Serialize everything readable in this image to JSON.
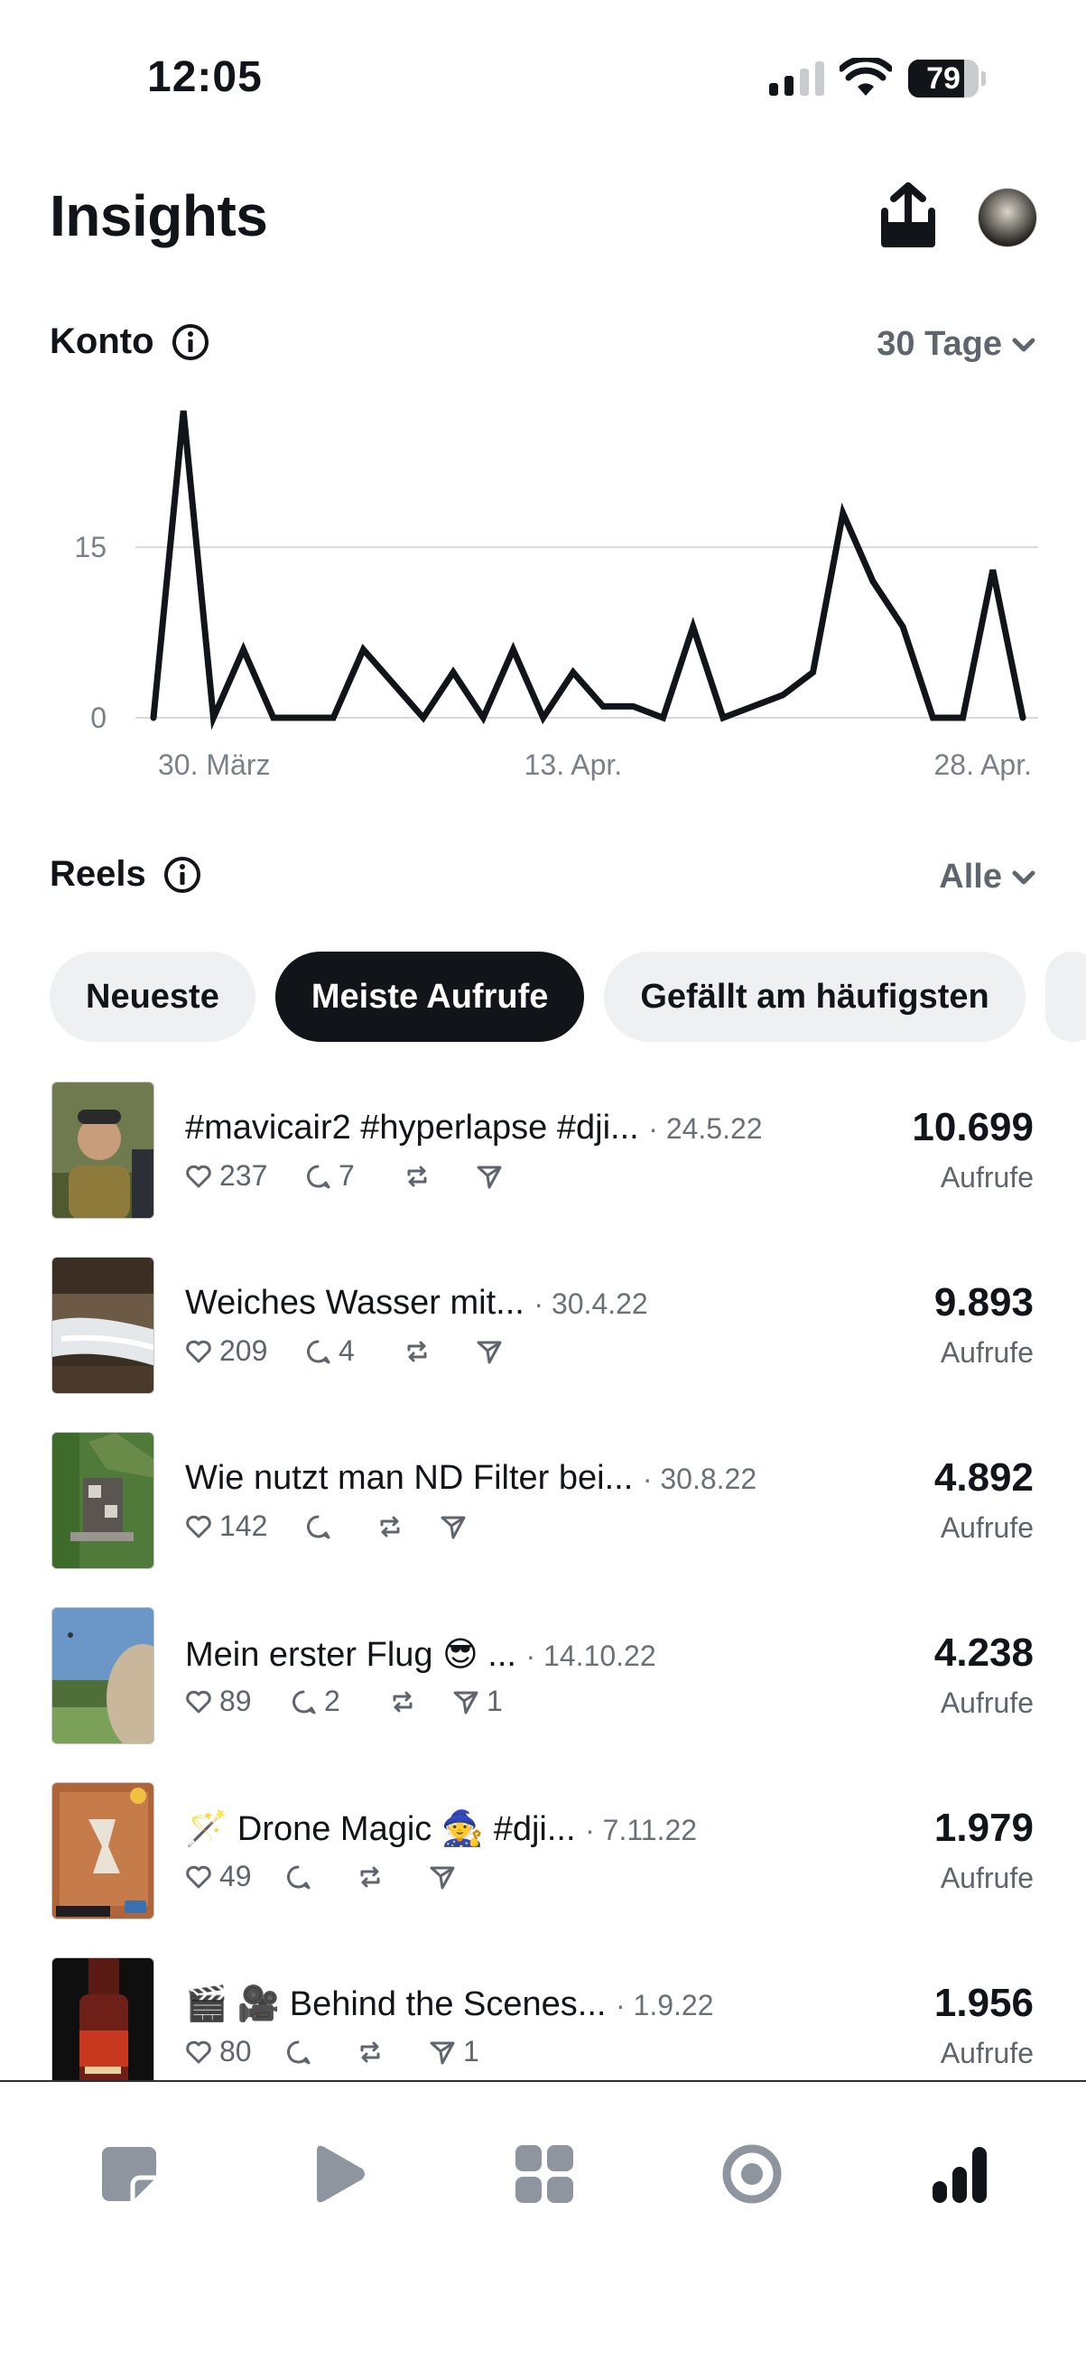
{
  "status_bar": {
    "time": "12:05",
    "battery": "79",
    "battery_level": 0.79
  },
  "header": {
    "title": "Insights"
  },
  "account": {
    "title": "Konto",
    "range": "30 Tage",
    "chart_data": {
      "type": "line",
      "x_tick_labels": [
        "30. März",
        "13. Apr.",
        "28. Apr."
      ],
      "y_tick_labels": [
        "0",
        "15"
      ],
      "ylim": [
        0,
        27
      ],
      "grid": true,
      "values": [
        0,
        27,
        0,
        6,
        0,
        0,
        0,
        6,
        3,
        0,
        4,
        0,
        6,
        0,
        4,
        1,
        1,
        0,
        8,
        0,
        1,
        2,
        4,
        18,
        12,
        8,
        0,
        0,
        13,
        0
      ],
      "x_tick_index": [
        0,
        14,
        29
      ]
    }
  },
  "reels": {
    "title": "Reels",
    "filter": "Alle",
    "chips": [
      "Neueste",
      "Meiste Aufrufe",
      "Gefällt am häufigsten"
    ],
    "active_chip": 1,
    "views_label": "Aufrufe",
    "items": [
      {
        "title": "#mavicair2 #hyperlapse #dji...",
        "date": "· 24.5.22",
        "likes": "237",
        "comments": "7",
        "shares": "",
        "views": "10.699"
      },
      {
        "title": "Weiches Wasser mit...",
        "date": "· 30.4.22",
        "likes": "209",
        "comments": "4",
        "shares": "",
        "views": "9.893"
      },
      {
        "title": "Wie nutzt man ND Filter bei...",
        "date": "· 30.8.22",
        "likes": "142",
        "comments": "",
        "shares": "",
        "views": "4.892"
      },
      {
        "title": "Mein erster Flug 😎 ...",
        "date": "· 14.10.22",
        "likes": "89",
        "comments": "2",
        "shares": "1",
        "views": "4.238"
      },
      {
        "title": "🪄 Drone Magic 🧙 #dji...",
        "date": "· 7.11.22",
        "likes": "49",
        "comments": "",
        "shares": "",
        "views": "1.979"
      },
      {
        "title": "🎬 🎥 Behind the Scenes...",
        "date": "· 1.9.22",
        "likes": "80",
        "comments": "",
        "shares": "1",
        "views": "1.956"
      }
    ]
  },
  "tab_bar": {
    "icons": [
      "threads-icon",
      "play-icon",
      "grid-icon",
      "target-icon",
      "insights-icon"
    ],
    "active": 4
  }
}
